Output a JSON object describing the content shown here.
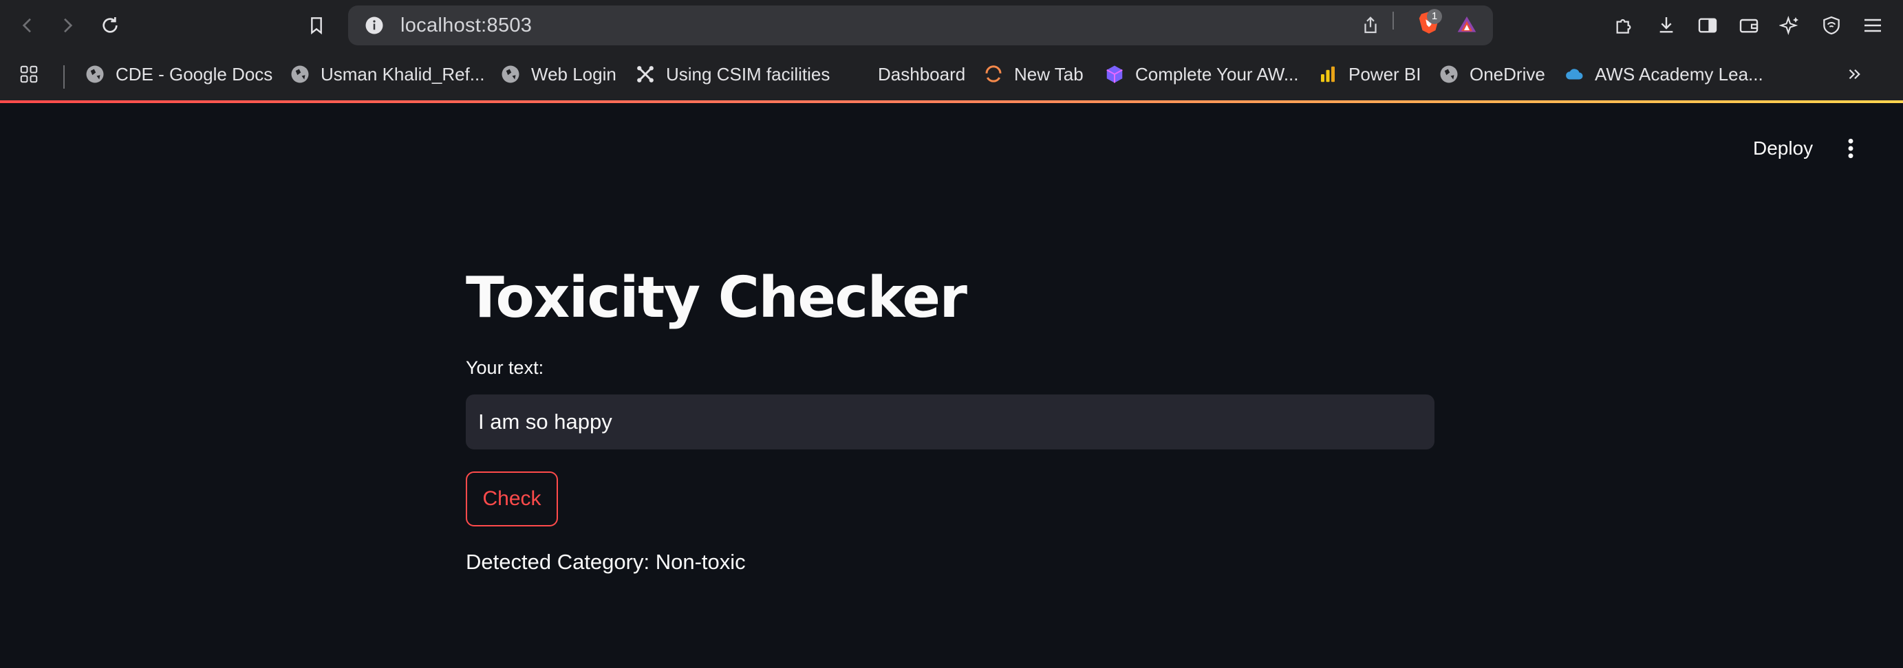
{
  "browser": {
    "url": "localhost:8503",
    "extension_badge_count": "1",
    "bookmarks": [
      {
        "label": "CDE - Google Docs",
        "icon": "globe-icon"
      },
      {
        "label": "Usman Khalid_Ref...",
        "icon": "globe-icon"
      },
      {
        "label": "Web Login",
        "icon": "globe-icon"
      },
      {
        "label": "Using CSIM facilities",
        "icon": "joomla-icon"
      },
      {
        "label": "Dashboard",
        "icon": "none"
      },
      {
        "label": "New Tab",
        "icon": "arc-icon"
      },
      {
        "label": "Complete Your AW...",
        "icon": "cube-icon"
      },
      {
        "label": "Power BI",
        "icon": "powerbi-icon"
      },
      {
        "label": "OneDrive",
        "icon": "globe-icon"
      },
      {
        "label": "AWS Academy Lea...",
        "icon": "cloud-icon"
      }
    ],
    "colors": {
      "accent_start": "#ff4b4b",
      "accent_end": "#ffd54f",
      "chrome_bg": "#202124"
    }
  },
  "app": {
    "deploy_label": "Deploy",
    "title": "Toxicity Checker",
    "input_label": "Your text:",
    "input_value": "I am so happy",
    "check_label": "Check",
    "result_text": "Detected Category: Non-toxic",
    "colors": {
      "background": "#0e1117",
      "primary": "#ff4b4b",
      "input_bg": "#262730"
    }
  }
}
